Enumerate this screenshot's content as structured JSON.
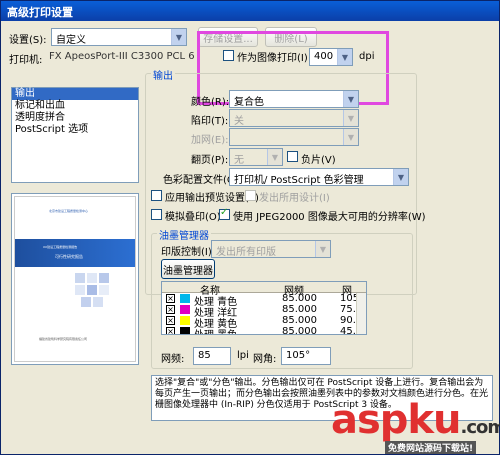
{
  "window": {
    "title": "高级打印设置"
  },
  "settings": {
    "label": "设置(S):",
    "value": "自定义",
    "save_label": "存储设置...",
    "delete_label": "删除(L)"
  },
  "printer": {
    "label": "打印机:",
    "value": "FX ApeosPort-III C3300 PCL 6"
  },
  "bitmap": {
    "label": "作为图像打印(I)",
    "checked": false,
    "dpi_value": "400",
    "dpi_unit": "dpi"
  },
  "sidebar": {
    "items": [
      {
        "label": "输出",
        "selected": true
      },
      {
        "label": "标记和出血",
        "selected": false
      },
      {
        "label": "透明度拼合",
        "selected": false
      },
      {
        "label": "PostScript 选项",
        "selected": false
      }
    ]
  },
  "output": {
    "title": "输出",
    "color": {
      "label": "颜色(R):",
      "value": "复合色"
    },
    "trapping": {
      "label": "陷印(T):",
      "value": "关"
    },
    "flip": {
      "label": "加网(E):",
      "value": ""
    },
    "flip2": {
      "label": "翻页(P):",
      "value": "无"
    },
    "negative": {
      "label": "负片(V)",
      "checked": false
    },
    "profile": {
      "label": "色彩配置文件(O):",
      "value": "打印机/ PostScript 色彩管理"
    },
    "apply_preview": {
      "label": "应用输出预览设置(Y)",
      "checked": false
    },
    "send_printer": {
      "label": "发出所用设计(I)",
      "checked": false
    },
    "simulate": {
      "label": "模拟叠印(O)",
      "checked": false
    },
    "jpeg2000": {
      "label": "使用 JPEG2000 图像最大可用的分辨率(W)",
      "checked": true
    }
  },
  "ink": {
    "group_title": "油墨管理器",
    "control_label": "印版控制(I):",
    "control_value": "发出所有印版",
    "manager_button": "油墨管理器",
    "columns": [
      "名称",
      "网频",
      "网"
    ],
    "rows": [
      {
        "name": "处理 青色",
        "freq": "85.000",
        "angle": "105",
        "color": "#00b7eb"
      },
      {
        "name": "处理 洋红",
        "freq": "85.000",
        "angle": "75.",
        "color": "#e000c0"
      },
      {
        "name": "处理 黄色",
        "freq": "85.000",
        "angle": "90.",
        "color": "#ffff00"
      },
      {
        "name": "处理 黑色",
        "freq": "85.000",
        "angle": "45.",
        "color": "#000000"
      }
    ],
    "freq_label": "网频:",
    "freq_value": "85",
    "freq_unit": "lpi",
    "angle_label": "网角:",
    "angle_value": "105°"
  },
  "description": "选择\"复合\"或\"分色\"输出。分色输出仅可在 PostScript 设备上进行。复合输出会为每页产生一页输出；而分色输出会按照油墨列表中的参数对文档颜色进行分色。在光栅图像处理器中 (In-RIP) 分色仅适用于 PostScript 3 设备。",
  "preview": {
    "line1": "北京市建设工程质量检测中心",
    "line2": "XX建设工程质量检测报告",
    "line3": "可行性研究报告",
    "footer": "福建省建筑科学研究院有限责任公司"
  },
  "watermark": {
    "main": "aspku",
    "suffix": ".com",
    "sub": "免费网站源码下载站!"
  }
}
